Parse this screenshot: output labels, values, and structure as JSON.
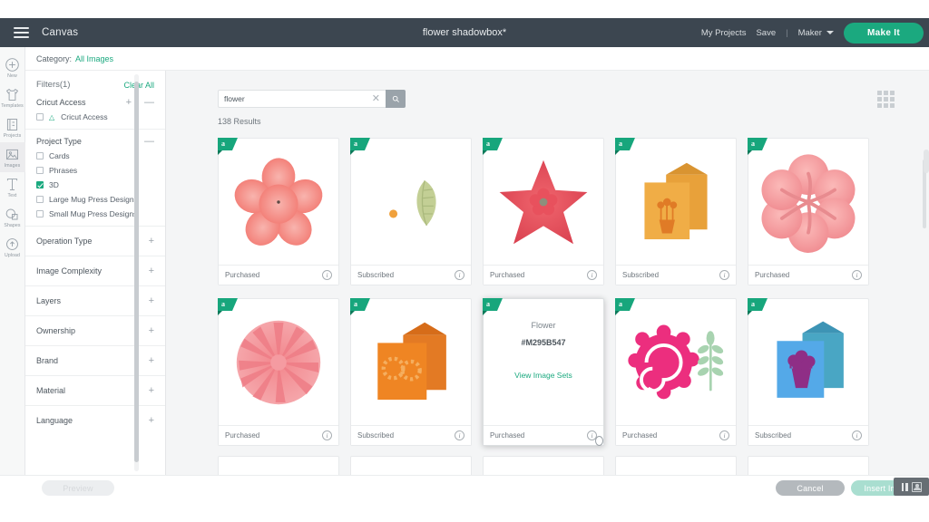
{
  "topbar": {
    "menu_icon": "hamburger-icon",
    "canvas_label": "Canvas",
    "doc_title": "flower shadowbox*",
    "my_projects": "My Projects",
    "save": "Save",
    "separator": "|",
    "machine": "Maker",
    "make_it": "Make It",
    "accent_color": "#1ba97f",
    "bar_color": "#3c4650"
  },
  "rail": {
    "items": [
      {
        "label": "New",
        "icon": "plus-circle-icon"
      },
      {
        "label": "Templates",
        "icon": "shirt-icon"
      },
      {
        "label": "Projects",
        "icon": "projects-icon"
      },
      {
        "label": "Images",
        "icon": "image-icon"
      },
      {
        "label": "Text",
        "icon": "text-icon"
      },
      {
        "label": "Shapes",
        "icon": "shapes-icon"
      },
      {
        "label": "Upload",
        "icon": "upload-cloud-icon"
      }
    ]
  },
  "category_bar": {
    "label": "Category:",
    "value": "All Images"
  },
  "filters": {
    "title": "Filters(1)",
    "clear_all": "Clear All",
    "cricut_access": {
      "title": "Cricut Access",
      "plus": "+",
      "minus": "—",
      "option": {
        "label": "Cricut Access",
        "checked": false,
        "badge": "access-badge-icon"
      }
    },
    "project_type": {
      "title": "Project Type",
      "minus": "—",
      "options": [
        {
          "label": "Cards",
          "checked": false
        },
        {
          "label": "Phrases",
          "checked": false
        },
        {
          "label": "3D",
          "checked": true
        },
        {
          "label": "Large Mug Press Designs",
          "checked": false
        },
        {
          "label": "Small Mug Press Designs",
          "checked": false
        }
      ]
    },
    "collapsed": [
      {
        "label": "Operation Type",
        "plus": "+"
      },
      {
        "label": "Image Complexity",
        "plus": "+"
      },
      {
        "label": "Layers",
        "plus": "+"
      },
      {
        "label": "Ownership",
        "plus": "+"
      },
      {
        "label": "Brand",
        "plus": "+"
      },
      {
        "label": "Material",
        "plus": "+"
      },
      {
        "label": "Language",
        "plus": "+"
      }
    ]
  },
  "search": {
    "value": "flower",
    "placeholder": "Search",
    "clear_icon": "close-icon",
    "search_icon": "search-icon"
  },
  "results": {
    "count_text": "138 Results",
    "grid_toggle_icon": "grid-view-icon",
    "cards": [
      {
        "status": "Purchased",
        "badge": "a",
        "art": "flower-5-petal-coral",
        "hovered": false
      },
      {
        "status": "Subscribed",
        "badge": "a",
        "art": "leaf-green-with-dot",
        "hovered": false
      },
      {
        "status": "Purchased",
        "badge": "a",
        "art": "flower-star-red",
        "hovered": false
      },
      {
        "status": "Subscribed",
        "badge": "a",
        "art": "card-orange-flowerpot",
        "hovered": false
      },
      {
        "status": "Purchased",
        "badge": "a",
        "art": "flower-6-petal-pink",
        "hovered": false
      },
      {
        "status": "Purchased",
        "badge": "a",
        "art": "flower-dahlia-pink",
        "hovered": false
      },
      {
        "status": "Subscribed",
        "badge": "a",
        "art": "card-orange-bow",
        "hovered": false
      },
      {
        "status": "Purchased",
        "badge": "a",
        "art": "flower-rose-with-leaf",
        "hovered": true,
        "hover": {
          "name": "Flower",
          "code": "#M295B547",
          "link": "View Image Sets"
        }
      },
      {
        "status": "Purchased",
        "badge": "a",
        "art": "rose-magenta-with-stem",
        "hovered": false
      },
      {
        "status": "Subscribed",
        "badge": "a",
        "art": "card-blue-bouquet",
        "hovered": false
      }
    ]
  },
  "bottombar": {
    "preview": "Preview",
    "cancel": "Cancel",
    "insert": "Insert Images"
  },
  "recorder": {
    "pause_icon": "pause-icon",
    "person_icon": "person-icon"
  }
}
